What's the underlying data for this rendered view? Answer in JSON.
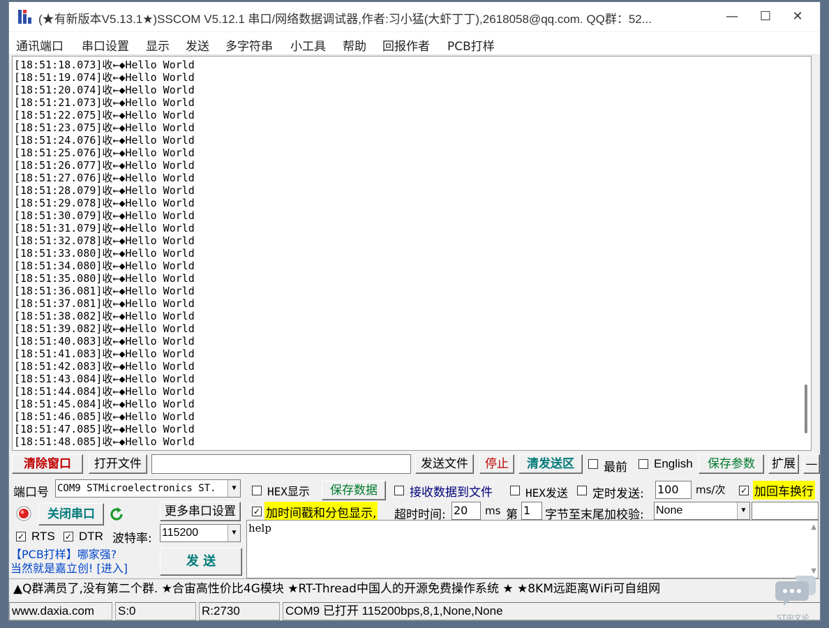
{
  "window": {
    "title": "(★有新版本V5.13.1★)SSCOM V5.12.1 串口/网络数据调试器,作者:习小猛(大虾丁丁),2618058@qq.com. QQ群：52...",
    "minimize": "—",
    "maximize": "☐",
    "close": "✕"
  },
  "menu": [
    "通讯端口",
    "串口设置",
    "显示",
    "发送",
    "多字符串",
    "小工具",
    "帮助",
    "回报作者",
    "PCB打样"
  ],
  "receive": {
    "lines": [
      "[18:51:18.073]收←◆Hello World",
      "[18:51:19.074]收←◆Hello World",
      "[18:51:20.074]收←◆Hello World",
      "[18:51:21.073]收←◆Hello World",
      "[18:51:22.075]收←◆Hello World",
      "[18:51:23.075]收←◆Hello World",
      "[18:51:24.076]收←◆Hello World",
      "[18:51:25.076]收←◆Hello World",
      "[18:51:26.077]收←◆Hello World",
      "[18:51:27.076]收←◆Hello World",
      "[18:51:28.079]收←◆Hello World",
      "[18:51:29.078]收←◆Hello World",
      "[18:51:30.079]收←◆Hello World",
      "[18:51:31.079]收←◆Hello World",
      "[18:51:32.078]收←◆Hello World",
      "[18:51:33.080]收←◆Hello World",
      "[18:51:34.080]收←◆Hello World",
      "[18:51:35.080]收←◆Hello World",
      "[18:51:36.081]收←◆Hello World",
      "[18:51:37.081]收←◆Hello World",
      "[18:51:38.082]收←◆Hello World",
      "[18:51:39.082]收←◆Hello World",
      "[18:51:40.083]收←◆Hello World",
      "[18:51:41.083]收←◆Hello World",
      "[18:51:42.083]收←◆Hello World",
      "[18:51:43.084]收←◆Hello World",
      "[18:51:44.084]收←◆Hello World",
      "[18:51:45.084]收←◆Hello World",
      "[18:51:46.085]收←◆Hello World",
      "[18:51:47.085]收←◆Hello World",
      "[18:51:48.085]收←◆Hello World"
    ]
  },
  "toolbar": {
    "clear_window": "清除窗口",
    "open_file": "打开文件",
    "file_path": "",
    "send_file": "发送文件",
    "stop": "停止",
    "clear_send": "清发送区",
    "topmost": "最前",
    "english": "English",
    "save_params": "保存参数",
    "expand": "扩展",
    "collapse": "—"
  },
  "port": {
    "label": "端口号",
    "value": "COM9 STMicroelectronics ST.",
    "hex_display": "HEX显示",
    "save_data": "保存数据",
    "recv_to_file": "接收数据到文件",
    "hex_send": "HEX发送",
    "timed_send": "定时发送:",
    "interval": "100",
    "interval_unit": "ms/次",
    "append_newline": "加回车换行"
  },
  "row3": {
    "close_port": "关闭串口",
    "more_settings": "更多串口设置",
    "timestamp": "加时间戳和分包显示,",
    "timeout_label": "超时时间:",
    "timeout_value": "20",
    "timeout_unit": "ms",
    "byte_prefix": "第",
    "byte_value": "1",
    "byte_suffix": "字节至末尾加校验:",
    "checksum": "None",
    "checksum_extra": ""
  },
  "row4": {
    "rts": "RTS",
    "dtr": "DTR",
    "baud_label": "波特率:",
    "baud_value": "115200"
  },
  "send": {
    "text": "help",
    "button": "发 送"
  },
  "promo": {
    "line1": "【PCB打样】哪家强?",
    "line2": "当然就是嘉立创! [进入]"
  },
  "marquee": "▲Q群满员了,没有第二个群. ★合宙高性价比4G模块 ★RT-Thread中国人的开源免费操作系统 ★ ★8KM远距离WiFi可自组网",
  "status": {
    "site": "www.daxia.com",
    "sent": "S:0",
    "received": "R:2730",
    "port_state": "COM9 已打开  115200bps,8,1,None,None"
  },
  "watermark": "ST中文论"
}
